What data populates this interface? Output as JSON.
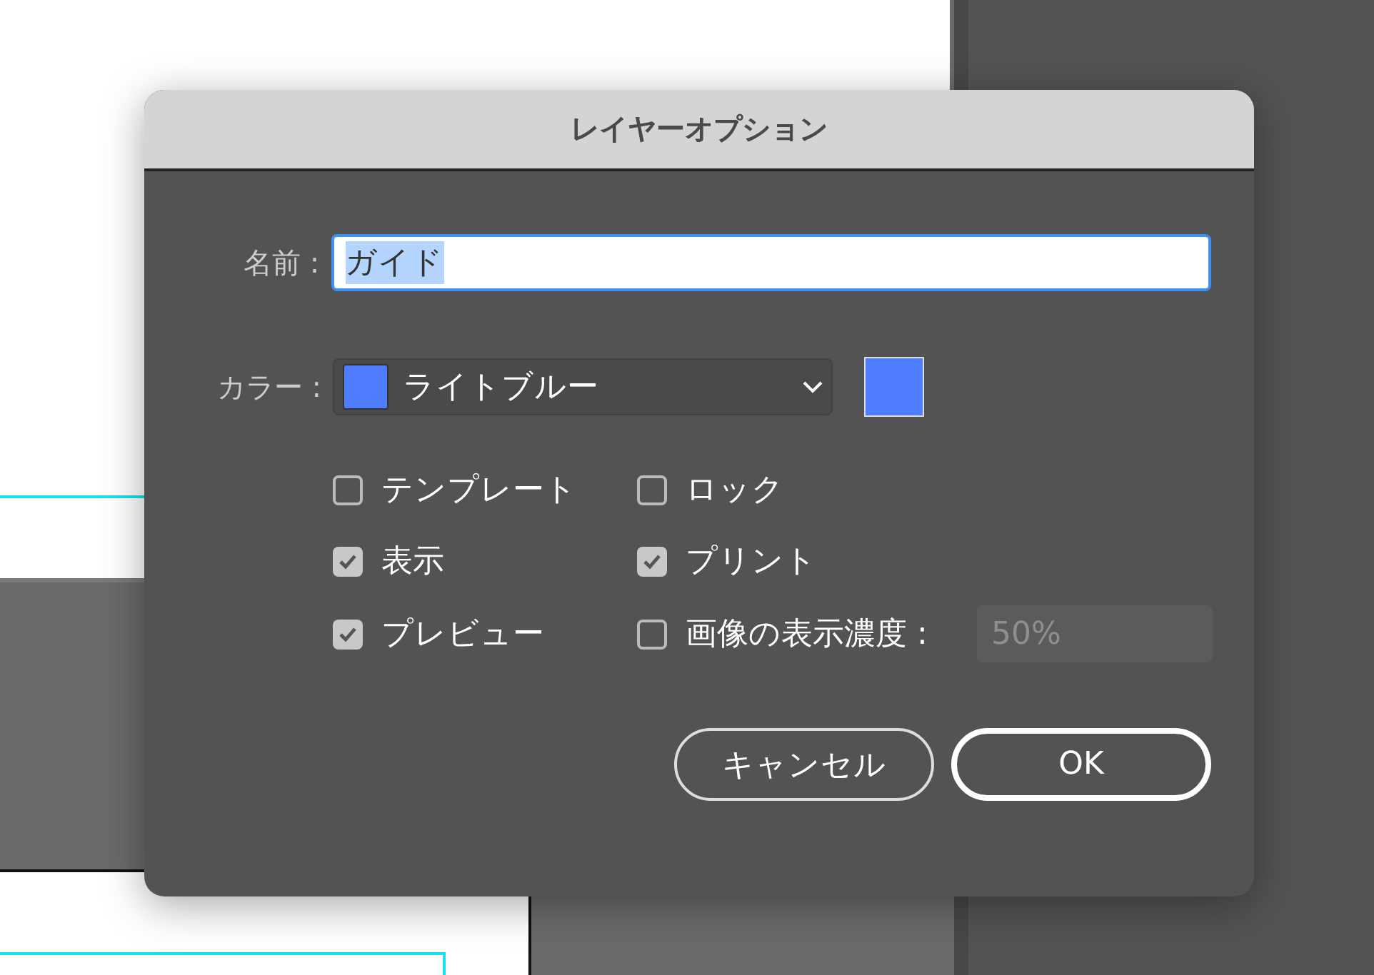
{
  "dialog": {
    "title": "レイヤーオプション",
    "name_field": {
      "label": "名前 :",
      "value": "ガイド",
      "selected": true
    },
    "color_field": {
      "label": "カラー :",
      "value": "ライトブルー",
      "color": "#4f7dff"
    },
    "options": [
      {
        "label": "テンプレート",
        "checked": false
      },
      {
        "label": "ロック",
        "checked": false
      },
      {
        "label": "表示",
        "checked": true
      },
      {
        "label": "プリント",
        "checked": true
      },
      {
        "label": "プレビュー",
        "checked": true
      },
      {
        "label": "画像の表示濃度 :",
        "checked": false
      }
    ],
    "dim_field": {
      "value": "50%",
      "disabled": true
    },
    "buttons": [
      {
        "label": "キャンセル",
        "default": false
      },
      {
        "label": "OK",
        "default": true
      }
    ]
  }
}
